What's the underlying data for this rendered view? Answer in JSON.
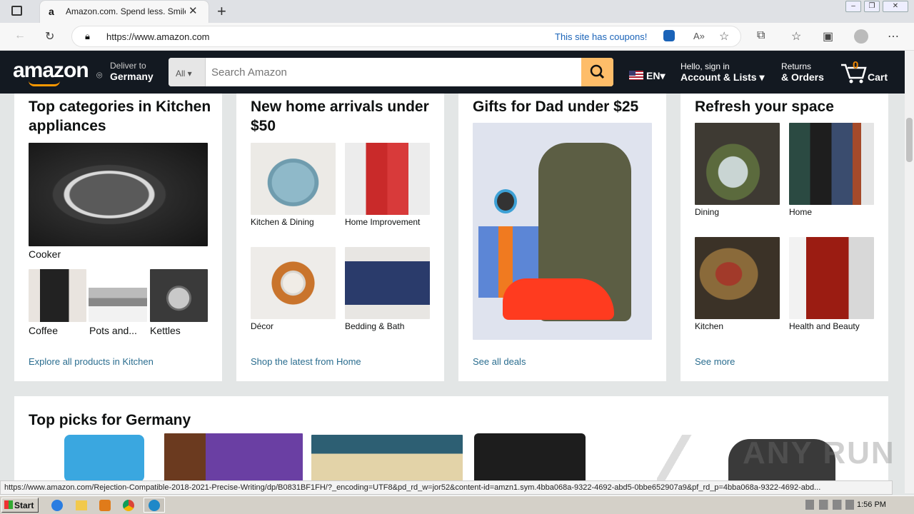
{
  "browser": {
    "tab_title": "Amazon.com. Spend less. Smile more.",
    "url": "https://www.amazon.com",
    "coupons_text": "This site has coupons!"
  },
  "header": {
    "logo": "amazon",
    "deliver_line1": "Deliver to",
    "deliver_line2": "Germany",
    "search_category": "All",
    "search_placeholder": "Search Amazon",
    "language": "EN",
    "account_line1": "Hello, sign in",
    "account_line2": "Account & Lists",
    "returns_line1": "Returns",
    "returns_line2": "& Orders",
    "cart_count": "0",
    "cart_label": "Cart"
  },
  "cards": [
    {
      "title": "Top categories in Kitchen appliances",
      "items": [
        "Cooker",
        "Coffee",
        "Pots and...",
        "Kettles"
      ],
      "link": "Explore all products in Kitchen"
    },
    {
      "title": "New home arrivals under $50",
      "items": [
        "Kitchen & Dining",
        "Home Improvement",
        "Décor",
        "Bedding & Bath"
      ],
      "link": "Shop the latest from Home"
    },
    {
      "title": "Gifts for Dad under $25",
      "items": [],
      "link": "See all deals"
    },
    {
      "title": "Refresh your space",
      "items": [
        "Dining",
        "Home",
        "Kitchen",
        "Health and Beauty"
      ],
      "link": "See more"
    }
  ],
  "picks": {
    "title": "Top picks for Germany"
  },
  "status_url": "https://www.amazon.com/Rejection-Compatible-2018-2021-Precise-Writing/dp/B0831BF1FH/?_encoding=UTF8&pd_rd_w=jor52&content-id=amzn1.sym.4bba068a-9322-4692-abd5-0bbe652907a9&pf_rd_p=4bba068a-9322-4692-abd...",
  "taskbar": {
    "start": "Start",
    "clock": "1:56 PM"
  },
  "watermark": "ANY RUN",
  "colors": {
    "header_bg": "#131921",
    "search_button": "#febd69",
    "link": "#2a6d8f",
    "accent": "#ff9900"
  }
}
